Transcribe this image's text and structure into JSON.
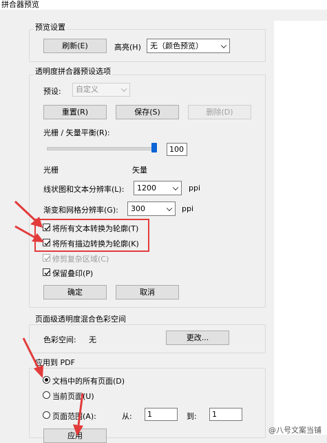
{
  "window": {
    "title": "拼合器预览"
  },
  "preview_settings": {
    "legend": "预览设置",
    "refresh_button": "刷新(E)",
    "highlight_label": "高亮(H)",
    "highlight_value": "无（颜色预览）"
  },
  "transparency": {
    "legend": "透明度拼合器预设选项",
    "preset_label": "预设:",
    "preset_value": "自定义",
    "reset_button": "重置(R)",
    "save_button": "保存(S)",
    "delete_button": "删除(D)",
    "raster_vector_label": "光栅 / 矢量平衡(R):",
    "balance_value": "100",
    "balance_fraction": 1.0,
    "raster_label": "光栅",
    "vector_label": "矢量",
    "line_art_label": "线状图和文本分辨率(L):",
    "line_art_value": "1200",
    "line_art_unit": "ppi",
    "gradient_label": "渐变和网格分辨率(G):",
    "gradient_value": "300",
    "gradient_unit": "ppi",
    "convert_text_label": "将所有文本转换为轮廓(T)",
    "convert_stroke_label": "将所有描边转换为轮廓(K)",
    "clip_complex_label": "修剪复杂区域(C)",
    "preserve_overprint_label": "保留叠印(P)",
    "ok_button": "确定",
    "cancel_button": "取消"
  },
  "color_space": {
    "legend": "页面级透明度混合色彩空间",
    "label": "色彩空间:",
    "value": "无",
    "change_button": "更改..."
  },
  "apply_pdf": {
    "legend": "应用到 PDF",
    "all_pages_label": "文档中的所有页面(D)",
    "current_page_label": "当前页面(U)",
    "page_range_label": "页面范围(A):",
    "from_label": "从:",
    "from_value": "1",
    "to_label": "到:",
    "to_value": "1",
    "apply_button": "应用"
  },
  "watermark": "@八号文案当铺",
  "colors": {
    "annotation_red": "#e23b3b"
  }
}
